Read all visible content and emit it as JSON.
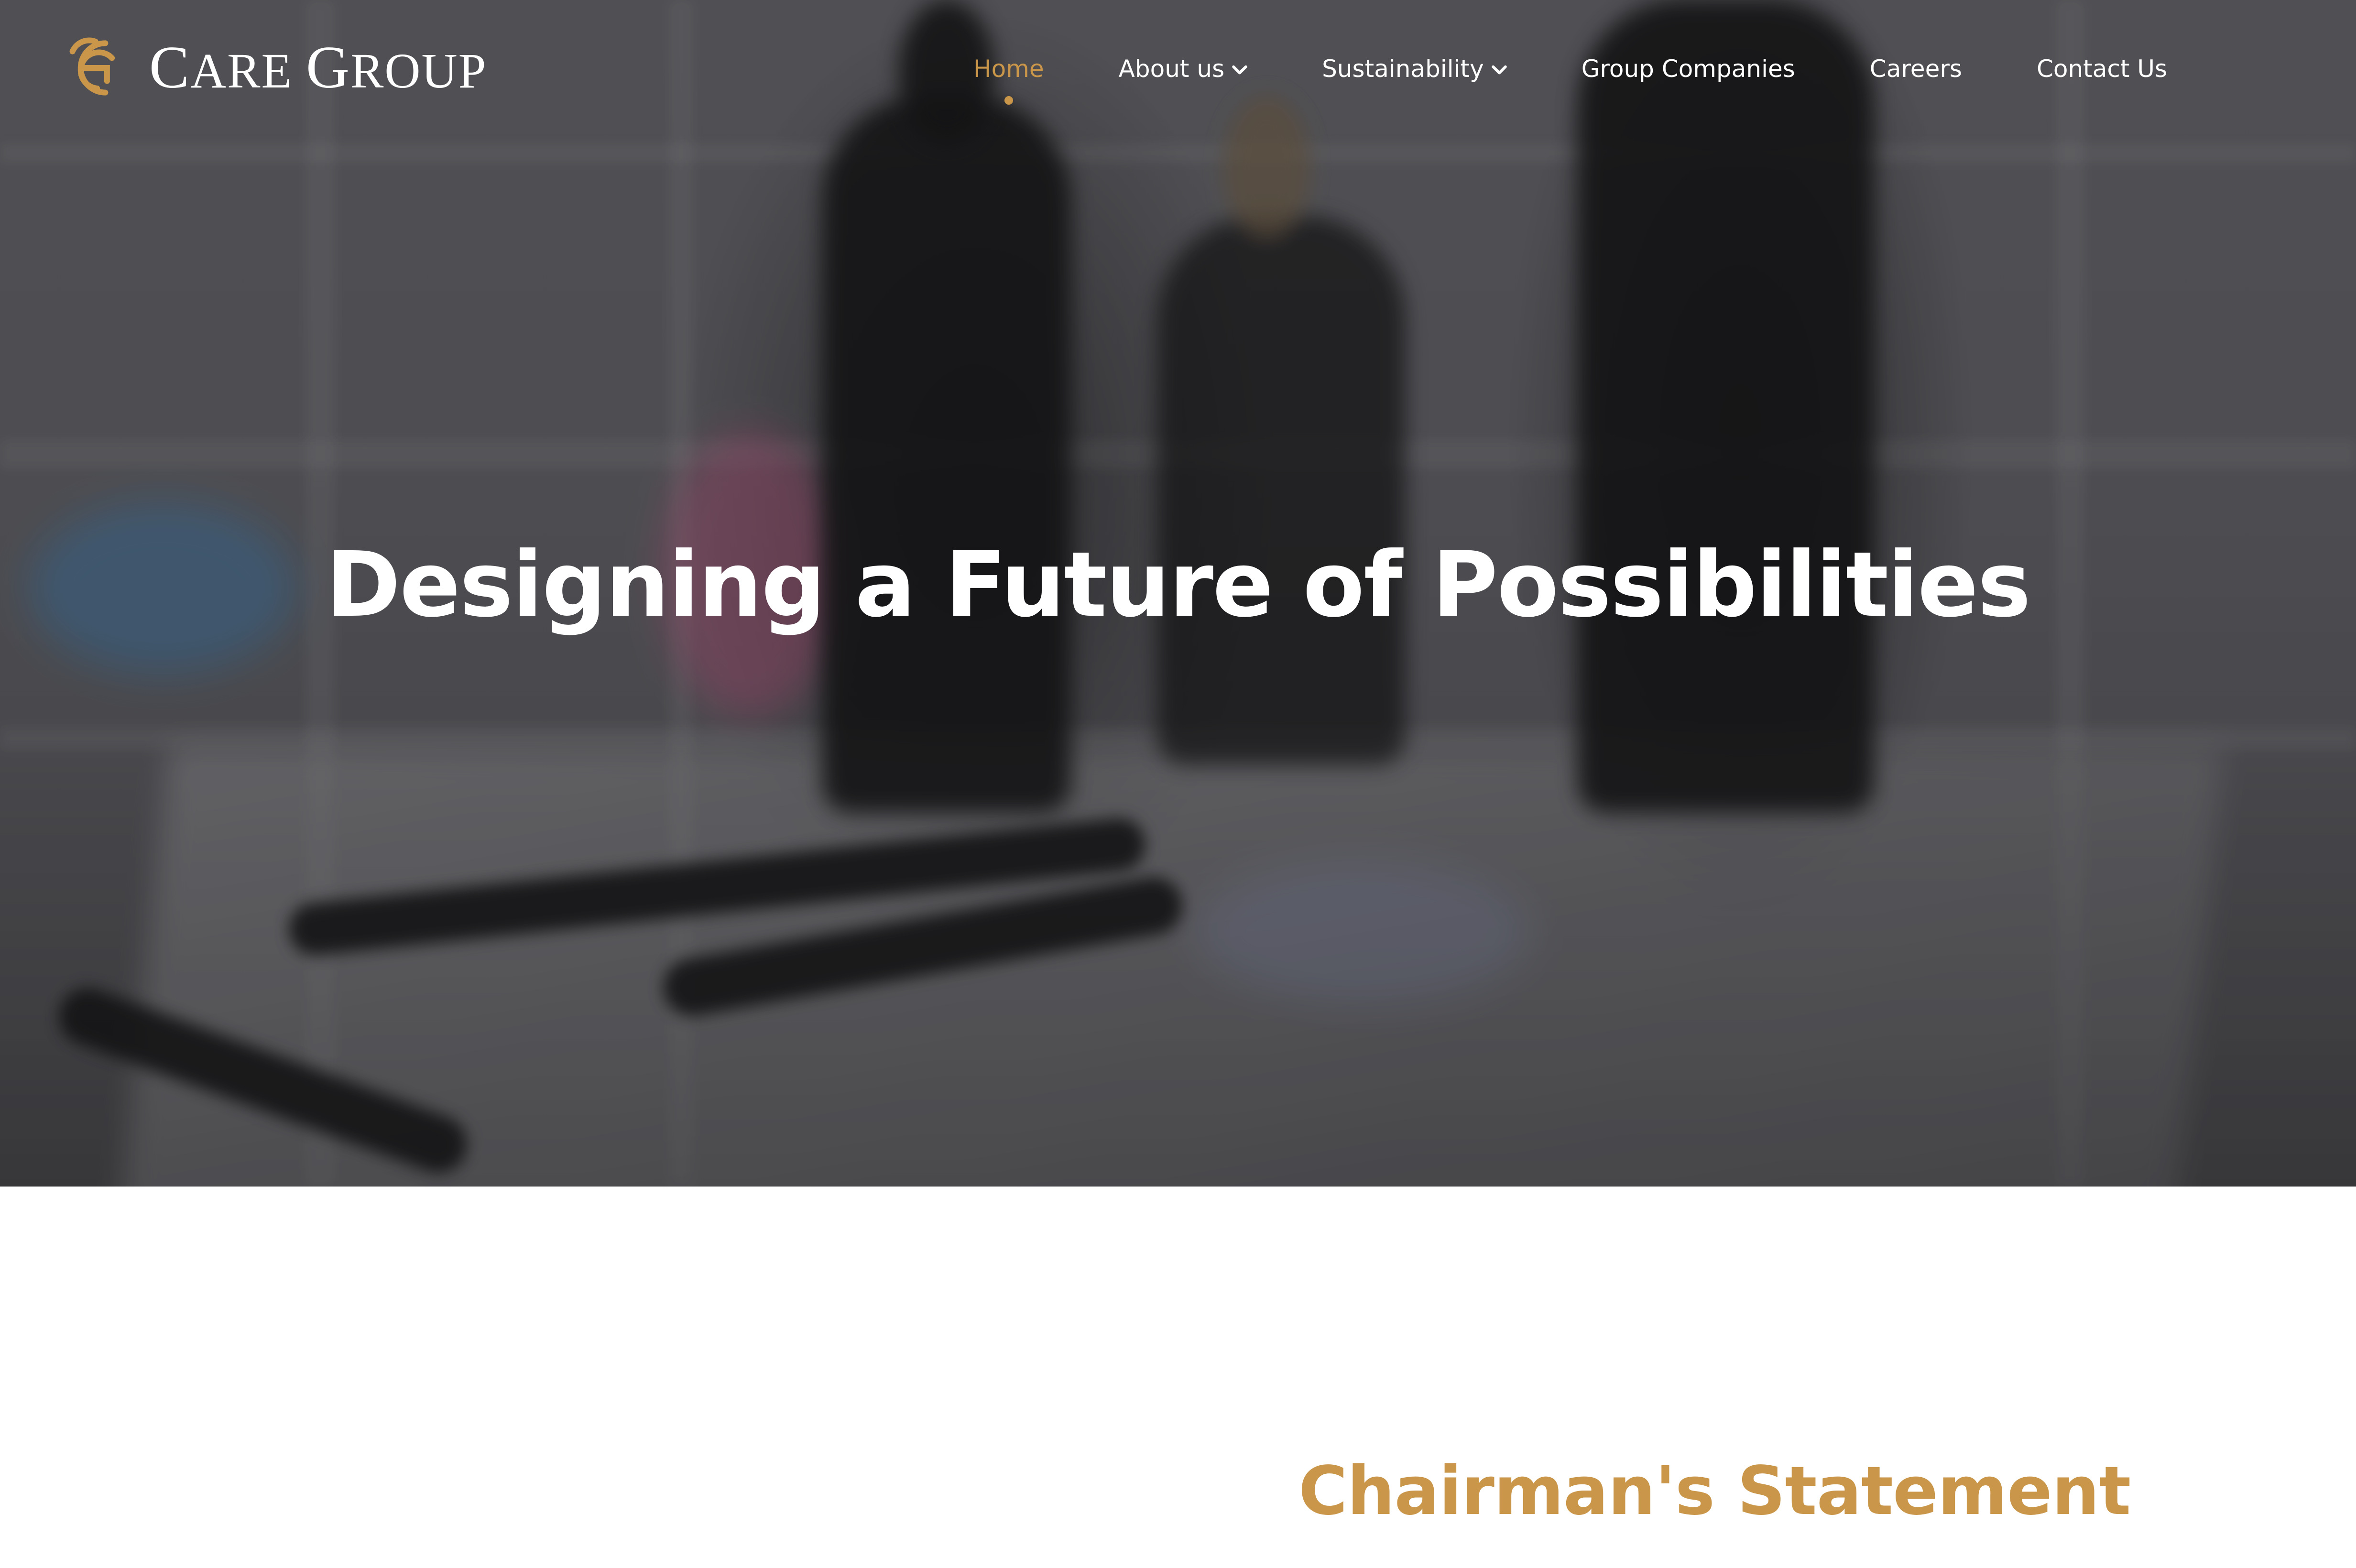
{
  "brand": {
    "name_first_initial": "C",
    "name_first_rest": "ARE",
    "name_second_initial": "G",
    "name_second_rest": "ROUP",
    "logo_icon": "cg-monogram-icon",
    "accent_color": "#c9964a"
  },
  "nav": {
    "items": [
      {
        "label": "Home",
        "active": true,
        "has_dropdown": false
      },
      {
        "label": "About us",
        "active": false,
        "has_dropdown": true
      },
      {
        "label": "Sustainability",
        "active": false,
        "has_dropdown": true
      },
      {
        "label": "Group Companies",
        "active": false,
        "has_dropdown": false
      },
      {
        "label": "Careers",
        "active": false,
        "has_dropdown": false
      },
      {
        "label": "Contact Us",
        "active": false,
        "has_dropdown": false
      }
    ],
    "dropdown_icon": "chevron-down-icon"
  },
  "hero": {
    "title": "Designing a Future of Possibilities"
  },
  "section": {
    "title": "Chairman's Statement"
  }
}
